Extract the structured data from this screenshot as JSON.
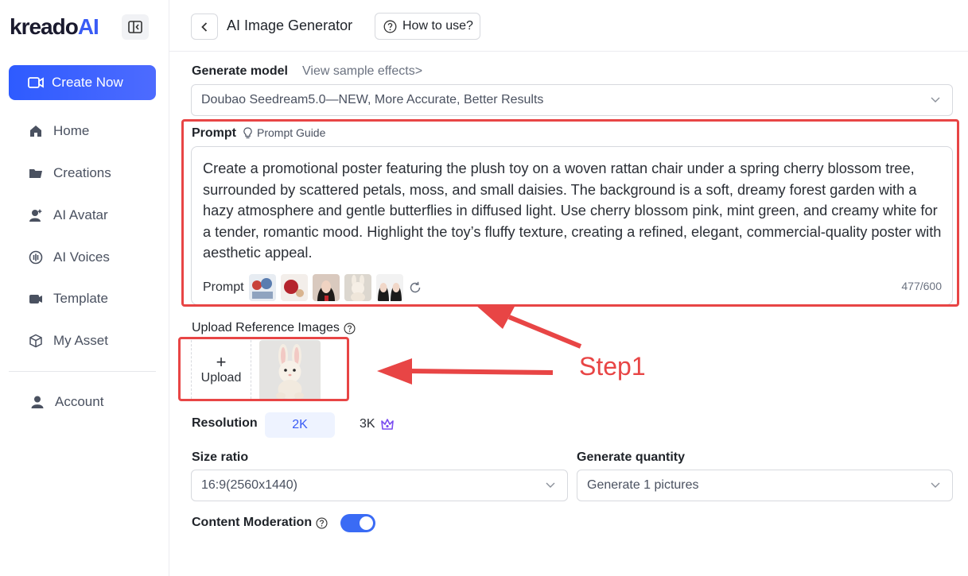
{
  "brand": {
    "logo_main": "kreado",
    "logo_ai": "AI"
  },
  "sidebar": {
    "create_label": "Create Now",
    "items": [
      {
        "label": "Home",
        "icon": "home-icon"
      },
      {
        "label": "Creations",
        "icon": "folder-icon"
      },
      {
        "label": "AI Avatar",
        "icon": "avatar-icon"
      },
      {
        "label": "AI Voices",
        "icon": "voice-icon"
      },
      {
        "label": "Template",
        "icon": "template-icon"
      },
      {
        "label": "My Asset",
        "icon": "cube-icon"
      }
    ],
    "account_label": "Account"
  },
  "header": {
    "title": "AI Image Generator",
    "howto_label": "How to use?"
  },
  "model": {
    "label": "Generate model",
    "sample_link": "View sample effects>",
    "selected": "Doubao Seedream5.0—NEW, More Accurate, Better Results"
  },
  "prompt": {
    "label": "Prompt",
    "guide_label": "Prompt Guide",
    "text": "Create a promotional poster featuring the plush toy on a woven rattan chair under a spring cherry blossom tree, surrounded by scattered petals, moss, and small daisies. The background is a soft, dreamy forest garden with a hazy atmosphere and gentle butterflies in diffused light. Use cherry blossom pink, mint green, and creamy white for a tender, romantic mood. Highlight the toy’s fluffy texture, creating a refined, elegant, commercial-quality poster with aesthetic appeal.",
    "row_label": "Prompt",
    "char_count": "477/600"
  },
  "upload": {
    "label": "Upload Reference Images",
    "button_plus": "+",
    "button_label": "Upload"
  },
  "resolution": {
    "label": "Resolution",
    "option_2k": "2K",
    "option_3k": "3K"
  },
  "size_ratio": {
    "label": "Size ratio",
    "selected": "16:9(2560x1440)"
  },
  "quantity": {
    "label": "Generate quantity",
    "selected": "Generate 1 pictures"
  },
  "moderation": {
    "label": "Content Moderation",
    "enabled": true
  },
  "annotation": {
    "step_label": "Step1",
    "color": "#e84545"
  },
  "colors": {
    "accent": "#3a5cf5",
    "toggle": "#3a6bf5"
  }
}
